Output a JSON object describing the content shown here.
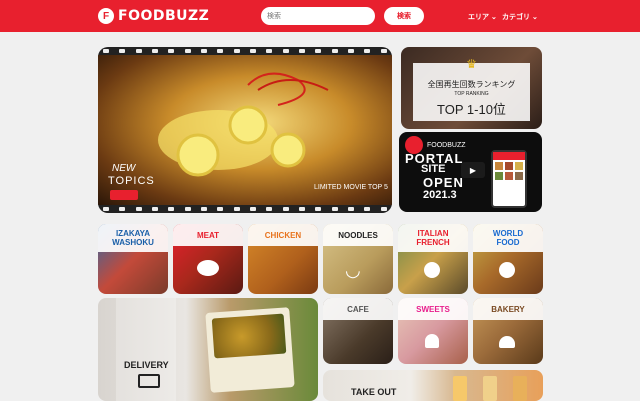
{
  "header": {
    "logo_mark": "F",
    "logo_text": "FOODBUZZ",
    "search_placeholder": "検索",
    "search_button": "検索",
    "nav_area": "エリア",
    "nav_category": "カテゴリ"
  },
  "hero": {
    "new_topics_1": "NEW",
    "new_topics_2": "TOPICS",
    "limited": "LIMITED MOVIE TOP 5"
  },
  "ranking": {
    "title": "全国再生回数ランキング",
    "sub": "TOP RANKING",
    "range": "TOP 1-10位"
  },
  "portal": {
    "brand": "FOODBUZZ",
    "line1": "PORTAL",
    "line2": "SITE",
    "line3": "OPEN",
    "date": "2021.3"
  },
  "categories": [
    {
      "label": "IZAKAYA\nWASHOKU",
      "color": "#1a5fa8"
    },
    {
      "label": "MEAT",
      "color": "#e8202e"
    },
    {
      "label": "CHICKEN",
      "color": "#e8731d"
    },
    {
      "label": "NOODLES",
      "color": "#222222"
    },
    {
      "label": "ITALIAN\nFRENCH",
      "color": "#e8202e"
    },
    {
      "label": "WORLD\nFOOD",
      "color": "#1a6bd1"
    }
  ],
  "categories2": [
    {
      "label": "CAFE",
      "color": "#555555"
    },
    {
      "label": "SWEETS",
      "color": "#e81e8c"
    },
    {
      "label": "BAKERY",
      "color": "#7a4a22"
    }
  ],
  "delivery": "DELIVERY",
  "takeout": "TAKE OUT"
}
